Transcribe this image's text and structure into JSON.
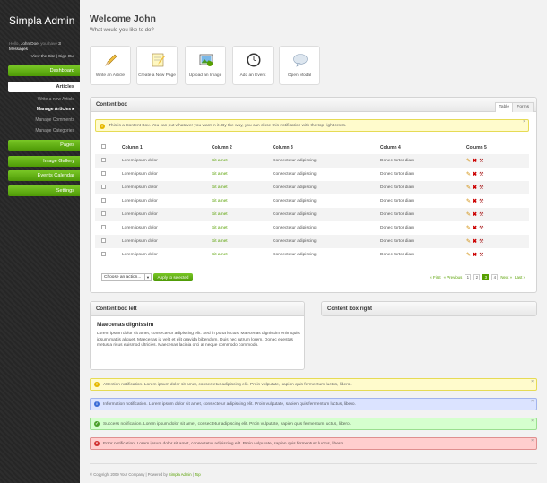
{
  "sidebar": {
    "brand": "Simpla Admin",
    "profile": {
      "hello": "Hello,",
      "user": "John Doe",
      "middle": ", you have",
      "messages": "3 Messages"
    },
    "links": {
      "view_site": "View the Site",
      "sep": " | ",
      "sign_out": "Sign Out"
    },
    "nav": [
      {
        "label": "Dashboard"
      },
      {
        "label": "Articles"
      },
      {
        "label": "Pages"
      },
      {
        "label": "Image Gallery"
      },
      {
        "label": "Events Calendar"
      },
      {
        "label": "Settings"
      }
    ],
    "sub": [
      "Write a new Article",
      "Manage Articles",
      "Manage Comments",
      "Manage Categories"
    ]
  },
  "header": {
    "title": "Welcome John",
    "subtitle": "What would you like to do?"
  },
  "shortcuts": [
    {
      "label": "Write an Article",
      "icon": "pencil-icon"
    },
    {
      "label": "Create a New Page",
      "icon": "page-icon"
    },
    {
      "label": "Upload an Image",
      "icon": "image-icon"
    },
    {
      "label": "Add an Event",
      "icon": "clock-icon"
    },
    {
      "label": "Open Modal",
      "icon": "speech-bubble-icon"
    }
  ],
  "content_box": {
    "title": "Content box",
    "tabs": [
      "Table",
      "Forms"
    ],
    "notice": "This is a Content Box. You can put whatever you want in it. By the way, you can close this notification with the top-right cross.",
    "columns": [
      "Column 1",
      "Column 2",
      "Column 3",
      "Column 4",
      "Column 5"
    ],
    "rows": [
      [
        "Lorem ipsum dolor",
        "Sit amet",
        "Consectetur adipiscing",
        "Donec tortor diam"
      ],
      [
        "Lorem ipsum dolor",
        "Sit amet",
        "Consectetur adipiscing",
        "Donec tortor diam"
      ],
      [
        "Lorem ipsum dolor",
        "Sit amet",
        "Consectetur adipiscing",
        "Donec tortor diam"
      ],
      [
        "Lorem ipsum dolor",
        "Sit amet",
        "Consectetur adipiscing",
        "Donec tortor diam"
      ],
      [
        "Lorem ipsum dolor",
        "Sit amet",
        "Consectetur adipiscing",
        "Donec tortor diam"
      ],
      [
        "Lorem ipsum dolor",
        "Sit amet",
        "Consectetur adipiscing",
        "Donec tortor diam"
      ],
      [
        "Lorem ipsum dolor",
        "Sit amet",
        "Consectetur adipiscing",
        "Donec tortor diam"
      ],
      [
        "Lorem ipsum dolor",
        "Sit amet",
        "Consectetur adipiscing",
        "Donec tortor diam"
      ]
    ],
    "bulk_select": "Choose an action...",
    "apply": "Apply to selected",
    "pager": {
      "first": "« First",
      "prev": "« Previous",
      "pages": [
        "1",
        "2",
        "3",
        "4"
      ],
      "current": "3",
      "next": "Next »",
      "last": "Last »"
    }
  },
  "box_left": {
    "title": "Content box left",
    "heading": "Maecenas dignissim",
    "text": "Lorem ipsum dolor sit amet, consectetur adipiscing elit. Sed in porta lectus. Maecenas dignissim enim quis ipsum mattis aliquet. Maecenas id velit et elit gravida bibendum. Duis nec rutrum lorem. Donec egestas metus a risus euismod ultricies. Maecenas lacinia orci at neque commodo commodo."
  },
  "box_right": {
    "title": "Content box right"
  },
  "notifications": [
    {
      "type": "attention",
      "text": "Attention notification. Lorem ipsum dolor sit amet, consectetur adipiscing elit. Proin vulputate, sapien quis fermentum luctus, libero."
    },
    {
      "type": "information",
      "text": "Information notification. Lorem ipsum dolor sit amet, consectetur adipiscing elit. Proin vulputate, sapien quis fermentum luctus, libero."
    },
    {
      "type": "success",
      "text": "Success notification. Lorem ipsum dolor sit amet, consectetur adipiscing elit. Proin vulputate, sapien quis fermentum luctus, libero."
    },
    {
      "type": "error",
      "text": "Error notification. Lorem ipsum dolor sit amet, consectetur adipiscing elit. Proin vulputate, sapien quis fermentum luctus, libero."
    }
  ],
  "footer": {
    "copyright": "© Copyright 2009 Your Company | Powered by ",
    "link": "Simpla Admin",
    "sep": " | ",
    "top": "Top"
  },
  "colors": {
    "accent": "#57a000",
    "sidebar": "#2b2b2b"
  }
}
